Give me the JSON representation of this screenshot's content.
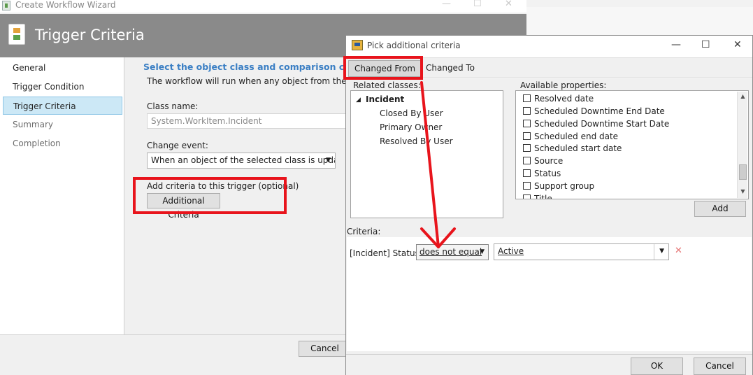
{
  "wizard": {
    "window_title": "Create Workflow Wizard",
    "header_title": "Trigger Criteria",
    "nav": [
      {
        "label": "General",
        "state": "normal"
      },
      {
        "label": "Trigger Condition",
        "state": "normal"
      },
      {
        "label": "Trigger Criteria",
        "state": "selected"
      },
      {
        "label": "Summary",
        "state": "disabled"
      },
      {
        "label": "Completion",
        "state": "disabled"
      }
    ],
    "content": {
      "heading": "Select the object class and comparison criteria",
      "description": "The workflow will run when any object from the class",
      "class_name_label": "Class name:",
      "class_name_value": "System.WorkItem.Incident",
      "change_event_label": "Change event:",
      "change_event_value": "When an object of the selected class is updated",
      "add_criteria_label": "Add criteria to this trigger (optional)",
      "additional_criteria_button": "Additional Criteria"
    },
    "footer": {
      "cancel_label": "Cancel"
    }
  },
  "pick": {
    "window_title": "Pick additional criteria",
    "tabs": [
      {
        "label": "Changed From",
        "active": true
      },
      {
        "label": "Changed To",
        "active": false
      }
    ],
    "related_classes_label": "Related classes:",
    "related_classes": {
      "root": "Incident",
      "children": [
        "Closed By User",
        "Primary Owner",
        "Resolved By User"
      ]
    },
    "available_properties_label": "Available properties:",
    "available_properties": [
      "Resolved date",
      "Scheduled Downtime End Date",
      "Scheduled Downtime Start Date",
      "Scheduled end date",
      "Scheduled start date",
      "Source",
      "Status",
      "Support group",
      "Title"
    ],
    "add_button": "Add",
    "criteria_label": "Criteria:",
    "criteria_row": {
      "property": "[Incident] Status",
      "operator": "does not equal",
      "value": "Active"
    },
    "ok_label": "OK",
    "cancel_label": "Cancel"
  },
  "colors": {
    "highlight_red": "#e8141c",
    "heading_blue": "#3b7fc4",
    "header_gray": "#8a8a8a",
    "nav_selected": "#cce8f6"
  }
}
